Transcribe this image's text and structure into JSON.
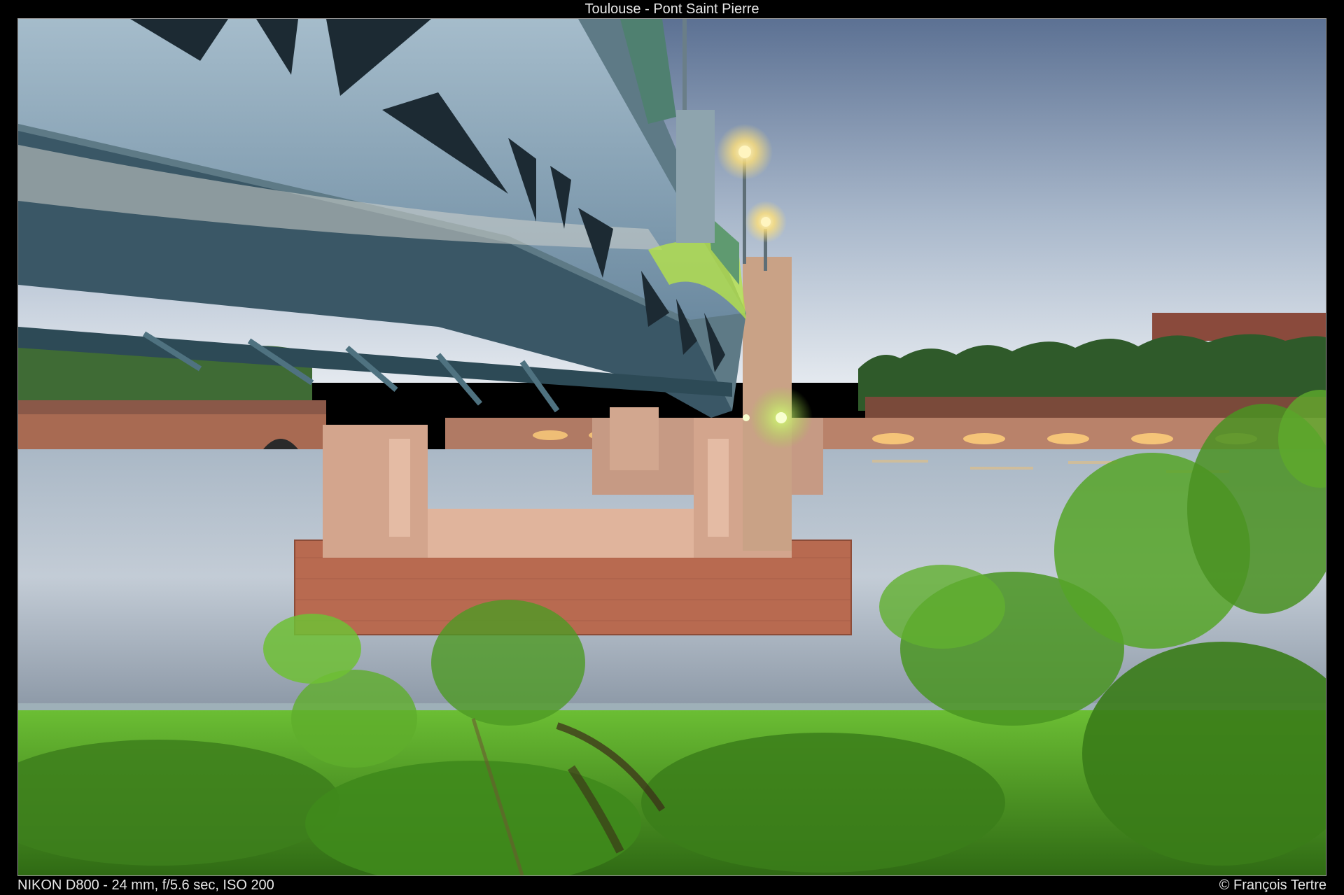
{
  "photo": {
    "title": "Toulouse - Pont Saint Pierre",
    "exif": "NIKON D800 - 24 mm, f/5.6 sec, ISO 200",
    "copyright": "© François Tertre"
  },
  "colors": {
    "sky_top": "#5f7497",
    "sky_bottom": "#dfe6ee",
    "water": "#b8c4d0",
    "bridge_steel": "#8fa9bd",
    "pier_brick": "#c98a6f",
    "grass": "#5aa52a",
    "foliage": "#3f8f1f",
    "lamp_glow": "#ffe07a"
  }
}
